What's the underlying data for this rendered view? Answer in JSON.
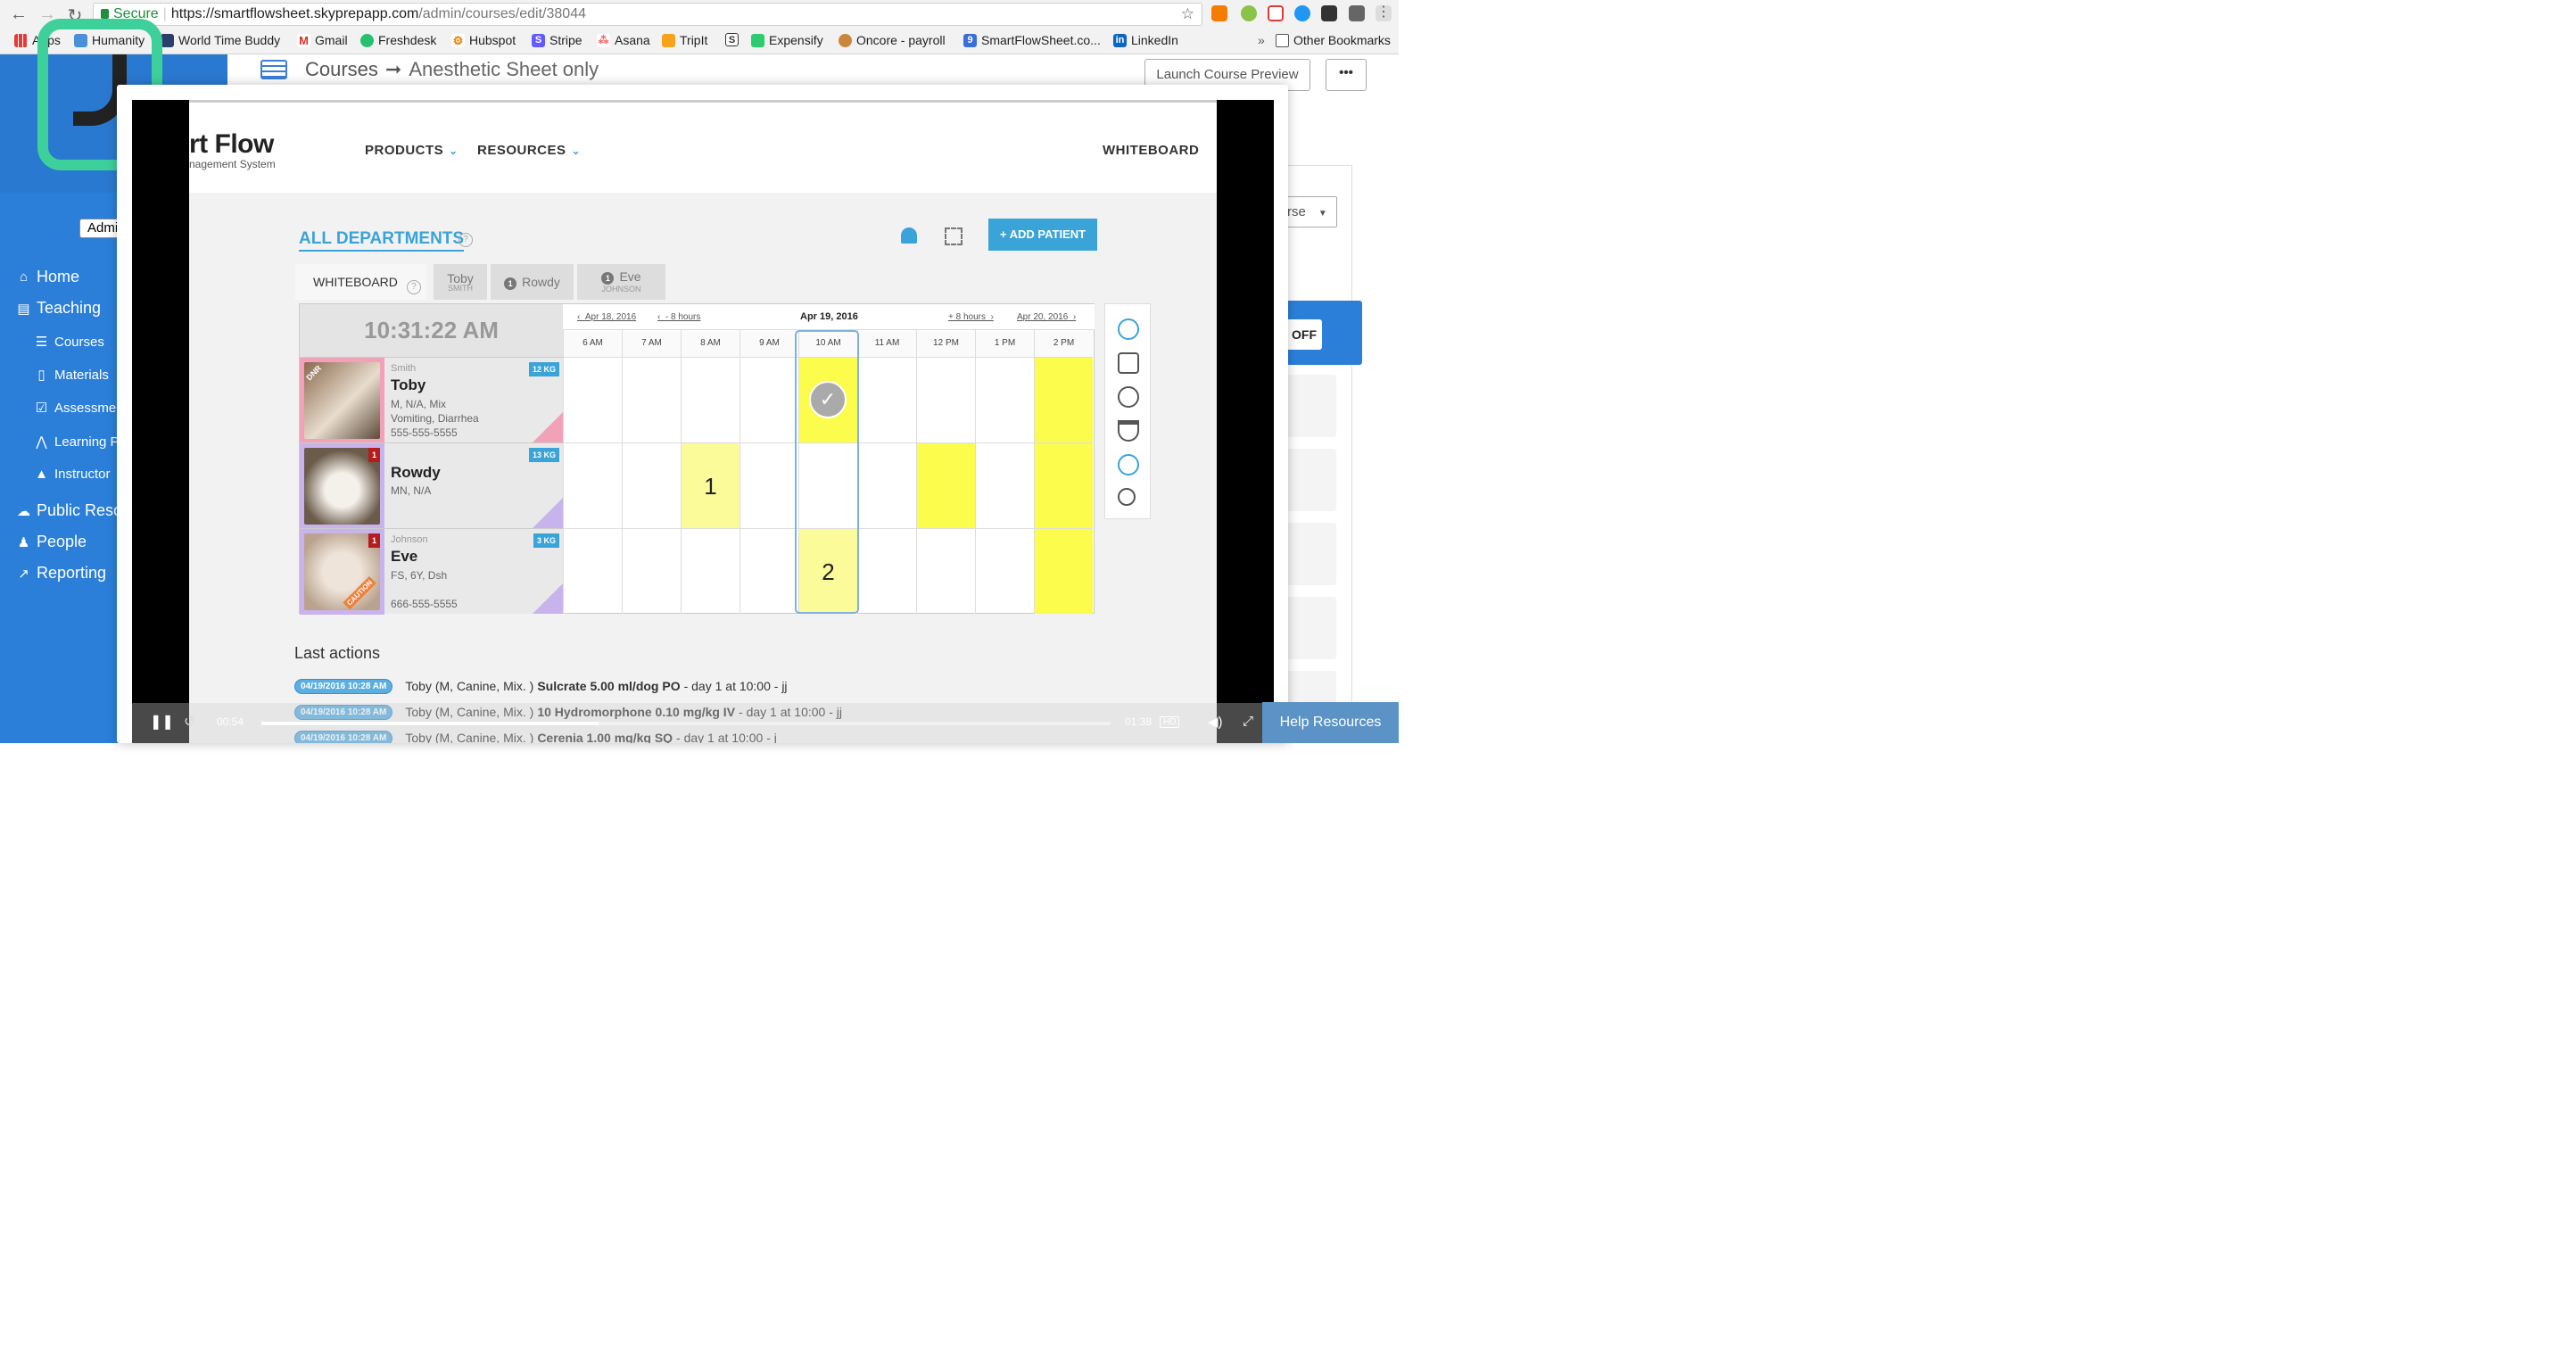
{
  "browser": {
    "secure_label": "Secure",
    "url_host": "https://smartflowsheet.skyprepapp.com",
    "url_path": "/admin/courses/edit/38044",
    "bookmarks": [
      "Apps",
      "Humanity",
      "World Time Buddy",
      "Gmail",
      "Freshdesk",
      "Hubspot",
      "Stripe",
      "Asana",
      "TripIt",
      "",
      "Expensify",
      "Oncore - payroll",
      "SmartFlowSheet.co...",
      "LinkedIn"
    ],
    "overflow": "»",
    "other_bookmarks": "Other Bookmarks"
  },
  "sidebar": {
    "admin_select": "Admi",
    "items": [
      {
        "label": "Home",
        "icon": "home-icon"
      },
      {
        "label": "Teaching",
        "icon": "book-icon"
      },
      {
        "label": "Courses",
        "icon": "list-icon"
      },
      {
        "label": "Materials",
        "icon": "file-icon"
      },
      {
        "label": "Assessmen",
        "icon": "check-square-icon"
      },
      {
        "label": "Learning P",
        "icon": "road-icon"
      },
      {
        "label": "Instructor",
        "icon": "graduation-cap-icon"
      },
      {
        "label": "Public Reso",
        "icon": "cloud-icon"
      },
      {
        "label": "People",
        "icon": "person-icon"
      },
      {
        "label": "Reporting",
        "icon": "chart-icon"
      }
    ]
  },
  "header": {
    "crumb_root": "Courses",
    "crumb_arrow": "➞",
    "crumb_current": "Anesthetic Sheet only",
    "launch_button": "Launch Course Preview",
    "more_button": "•••"
  },
  "right": {
    "select_text": "rse",
    "off_button": "OFF"
  },
  "video": {
    "brand": "rt Flow",
    "brand_sub": "nagement System",
    "nav_products": "PRODUCTS",
    "nav_resources": "RESOURCES",
    "nav_whiteboard": "WHITEBOARD",
    "all_departments": "ALL DEPARTMENTS",
    "add_patient": "+ ADD PATIENT",
    "tabs": [
      {
        "label": "WHITEBOARD",
        "sub": "",
        "num": ""
      },
      {
        "label": "Toby",
        "sub": "SMITH",
        "num": ""
      },
      {
        "label": "Rowdy",
        "sub": "",
        "num": "1"
      },
      {
        "label": "Eve",
        "sub": "JOHNSON",
        "num": "1"
      }
    ],
    "clock": "10:31:22 AM",
    "date_prev_day": "Apr 18, 2016",
    "date_prev_hours": "- 8 hours",
    "date_current": "Apr 19, 2016",
    "date_next_hours": "+ 8 hours",
    "date_next_day": "Apr 20, 2016",
    "hours": [
      "6 AM",
      "7 AM",
      "8 AM",
      "9 AM",
      "10 AM",
      "11 AM",
      "12 PM",
      "1 PM",
      "2 PM"
    ],
    "patients": [
      {
        "owner": "Smith",
        "name": "Toby",
        "info1": "M, N/A, Mix",
        "info2": "Vomiting, Diarrhea",
        "phone": "555-555-5555",
        "weight": "12 KG",
        "tag": "DNR",
        "badge": ""
      },
      {
        "owner": "",
        "name": "Rowdy",
        "info1": "MN, N/A",
        "info2": "",
        "phone": "",
        "weight": "13 KG",
        "tag": "",
        "badge": "1"
      },
      {
        "owner": "Johnson",
        "name": "Eve",
        "info1": "FS, 6Y, Dsh",
        "info2": "",
        "phone": "666-555-5555",
        "weight": "3 KG",
        "tag": "CAUTION",
        "badge": "1"
      }
    ],
    "cell_values": {
      "rowdy_8am": "1",
      "eve_10am": "2"
    },
    "check_mark": "✓",
    "last_actions_title": "Last actions",
    "actions": [
      {
        "ts": "04/19/2016 10:28 AM",
        "who": "Toby (M, Canine, Mix. )",
        "what": "Sulcrate 5.00 ml/dog PO",
        "tail": "- day 1 at 10:00 - jj"
      },
      {
        "ts": "04/19/2016 10:28 AM",
        "who": "Toby (M, Canine, Mix. )",
        "what": "10 Hydromorphone 0.10 mg/kg IV",
        "tail": "- day 1 at 10:00 - jj"
      },
      {
        "ts": "04/19/2016 10:28 AM",
        "who": "Toby (M, Canine, Mix. )",
        "what": "Cerenia 1.00 mg/kg SQ",
        "tail": "- day 1 at 10:00 - j"
      }
    ],
    "time_elapsed": "00:54",
    "time_total": "01:38",
    "progress": 0.397,
    "hd": "HD"
  },
  "help_button": "Help Resources"
}
